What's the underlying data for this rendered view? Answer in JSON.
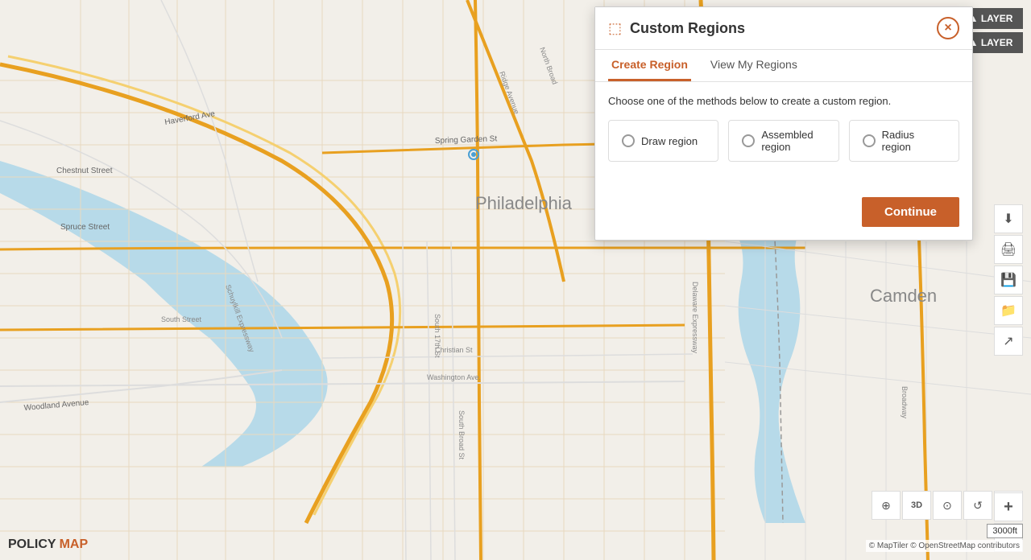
{
  "dialog": {
    "title": "Custom Regions",
    "title_icon": "⬚",
    "tabs": [
      {
        "label": "Create Region",
        "active": true
      },
      {
        "label": "View My Regions",
        "active": false
      }
    ],
    "instruction": "Choose one of the methods below to create a custom region.",
    "options": [
      {
        "label": "Draw region",
        "selected": false
      },
      {
        "label": "Assembled region",
        "selected": false
      },
      {
        "label": "Radius region",
        "selected": false
      }
    ],
    "continue_btn": "Continue",
    "close_icon": "×"
  },
  "top_right_buttons": [
    {
      "label": "▲ LAYER"
    },
    {
      "label": "▲ LAYER"
    }
  ],
  "toolbar": {
    "icons": [
      "⬇",
      "🖨",
      "💾",
      "📁",
      "↗"
    ]
  },
  "map": {
    "zoom_in": "+",
    "zoom_out": "−"
  },
  "bottom_icons": [
    {
      "icon": "⊕",
      "name": "select-tool"
    },
    {
      "icon": "3D",
      "name": "3d-toggle"
    },
    {
      "icon": "⊙",
      "name": "location-icon"
    },
    {
      "icon": "↺",
      "name": "refresh-icon"
    },
    {
      "icon": "⚙",
      "name": "settings-icon"
    }
  ],
  "logo": {
    "policy": "POLICY",
    "map": "MAP"
  },
  "scale": "3000ft",
  "attribution": "© MapTiler © OpenStreetMap contributors"
}
